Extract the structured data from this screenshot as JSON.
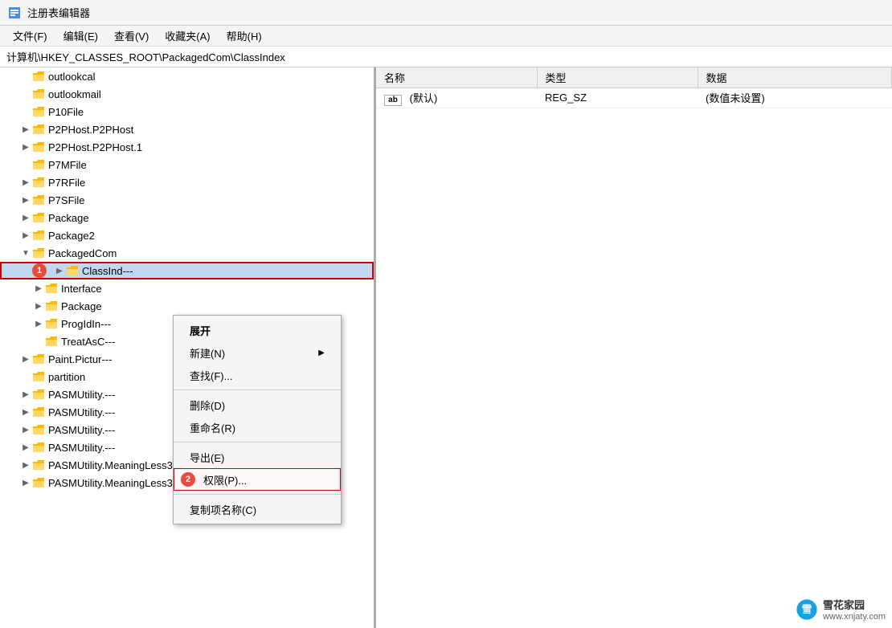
{
  "titleBar": {
    "icon": "regedit-icon",
    "title": "注册表编辑器"
  },
  "menuBar": {
    "items": [
      {
        "label": "文件(F)"
      },
      {
        "label": "编辑(E)"
      },
      {
        "label": "查看(V)"
      },
      {
        "label": "收藏夹(A)"
      },
      {
        "label": "帮助(H)"
      }
    ]
  },
  "addressBar": {
    "path": "计算机\\HKEY_CLASSES_ROOT\\PackagedCom\\ClassIndex"
  },
  "leftPanel": {
    "items": [
      {
        "id": "outlookcal",
        "label": "outlookcal",
        "indent": 2,
        "arrow": "empty",
        "level": 2
      },
      {
        "id": "outlookmail",
        "label": "outlookmail",
        "indent": 2,
        "arrow": "empty",
        "level": 2
      },
      {
        "id": "P10File",
        "label": "P10File",
        "indent": 2,
        "arrow": "empty",
        "level": 2
      },
      {
        "id": "P2PHost.P2PHost",
        "label": "P2PHost.P2PHost",
        "indent": 2,
        "arrow": "collapsed",
        "level": 2
      },
      {
        "id": "P2PHost.P2PHost.1",
        "label": "P2PHost.P2PHost.1",
        "indent": 2,
        "arrow": "collapsed",
        "level": 2
      },
      {
        "id": "P7MFile",
        "label": "P7MFile",
        "indent": 2,
        "arrow": "empty",
        "level": 2
      },
      {
        "id": "P7RFile",
        "label": "P7RFile",
        "indent": 2,
        "arrow": "collapsed",
        "level": 2
      },
      {
        "id": "P7SFile",
        "label": "P7SFile",
        "indent": 2,
        "arrow": "collapsed",
        "level": 2
      },
      {
        "id": "Package",
        "label": "Package",
        "indent": 2,
        "arrow": "collapsed",
        "level": 2
      },
      {
        "id": "Package2",
        "label": "Package2",
        "indent": 2,
        "arrow": "collapsed",
        "level": 2
      },
      {
        "id": "PackagedCom",
        "label": "PackagedCom",
        "indent": 2,
        "arrow": "expanded",
        "level": 2
      },
      {
        "id": "ClassIndex",
        "label": "ClassInd---",
        "indent": 3,
        "arrow": "collapsed",
        "level": 3,
        "selected": true,
        "badge": "1",
        "redBorder": true
      },
      {
        "id": "Interface",
        "label": "Interface",
        "indent": 3,
        "arrow": "collapsed",
        "level": 3
      },
      {
        "id": "Package3",
        "label": "Package",
        "indent": 3,
        "arrow": "collapsed",
        "level": 3
      },
      {
        "id": "ProgIdIndex",
        "label": "ProgIdIn---",
        "indent": 3,
        "arrow": "collapsed",
        "level": 3
      },
      {
        "id": "TreatAsClass",
        "label": "TreatAsC---",
        "indent": 3,
        "arrow": "empty",
        "level": 3
      },
      {
        "id": "Paint.Picture",
        "label": "Paint.Pictur---",
        "indent": 2,
        "arrow": "collapsed",
        "level": 2
      },
      {
        "id": "partition",
        "label": "partition",
        "indent": 2,
        "arrow": "empty",
        "level": 2
      },
      {
        "id": "PASMUtility1",
        "label": "PASMUtility.---",
        "indent": 2,
        "arrow": "collapsed",
        "level": 2
      },
      {
        "id": "PASMUtility2",
        "label": "PASMUtility.---",
        "indent": 2,
        "arrow": "collapsed",
        "level": 2
      },
      {
        "id": "PASMUtility3",
        "label": "PASMUtility.---",
        "indent": 2,
        "arrow": "collapsed",
        "level": 2
      },
      {
        "id": "PASMUtility4",
        "label": "PASMUtility.---",
        "indent": 2,
        "arrow": "collapsed",
        "level": 2
      },
      {
        "id": "PASMUtilityMeaningLess3",
        "label": "PASMUtility.MeaningLess3",
        "indent": 2,
        "arrow": "collapsed",
        "level": 2
      },
      {
        "id": "PASMUtilityMeaningLess3.2",
        "label": "PASMUtility.MeaningLess3.2",
        "indent": 2,
        "arrow": "collapsed",
        "level": 2
      }
    ]
  },
  "rightPanel": {
    "columns": [
      "名称",
      "类型",
      "数据"
    ],
    "rows": [
      {
        "name": "(默认)",
        "type": "REG_SZ",
        "data": "(数值未设置)",
        "icon": "ab"
      }
    ]
  },
  "contextMenu": {
    "items": [
      {
        "id": "expand",
        "label": "展开",
        "bold": true
      },
      {
        "id": "new",
        "label": "新建(N)",
        "hasArrow": true
      },
      {
        "id": "find",
        "label": "查找(F)..."
      },
      {
        "id": "sep1",
        "separator": true
      },
      {
        "id": "delete",
        "label": "删除(D)"
      },
      {
        "id": "rename",
        "label": "重命名(R)"
      },
      {
        "id": "sep2",
        "separator": true
      },
      {
        "id": "export",
        "label": "导出(E)"
      },
      {
        "id": "permissions",
        "label": "权限(P)...",
        "badge": "2",
        "highlighted": true
      },
      {
        "id": "sep3",
        "separator": true
      },
      {
        "id": "copy",
        "label": "复制项名称(C)"
      }
    ]
  },
  "watermark": {
    "text": "雪花家园",
    "url": "www.xnjaty.com"
  }
}
